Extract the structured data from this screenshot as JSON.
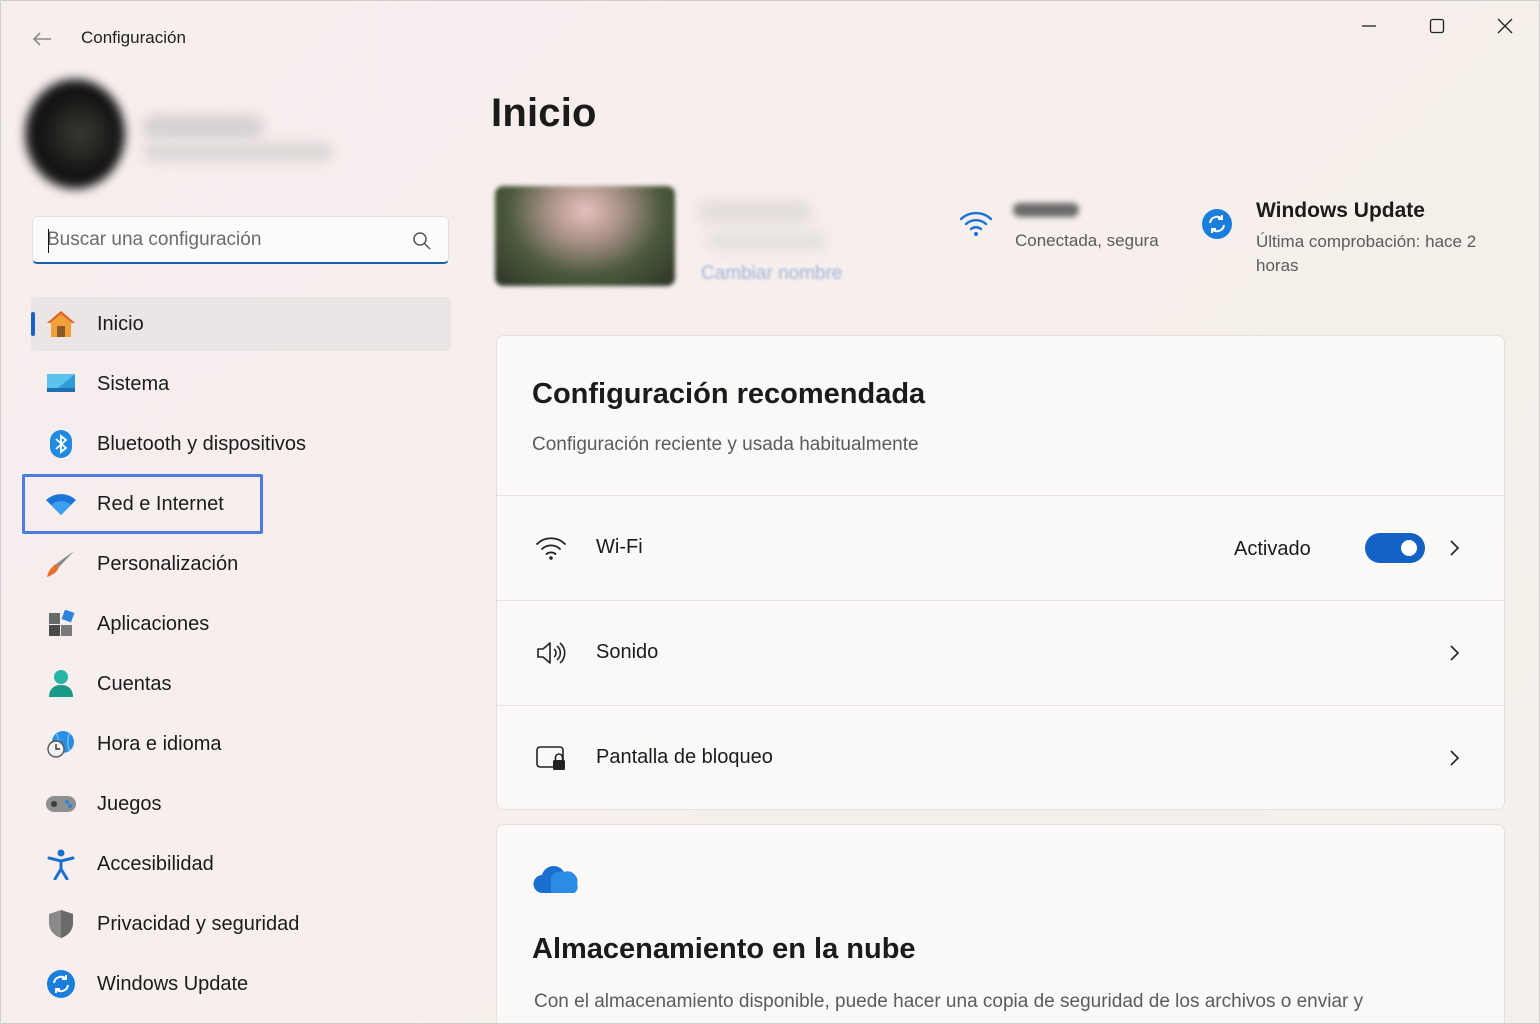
{
  "window": {
    "title": "Configuración"
  },
  "search": {
    "placeholder": "Buscar una configuración"
  },
  "sidebar": {
    "items": [
      {
        "label": "Inicio",
        "icon": "home-icon",
        "active": true
      },
      {
        "label": "Sistema",
        "icon": "system-icon"
      },
      {
        "label": "Bluetooth y dispositivos",
        "icon": "bluetooth-icon"
      },
      {
        "label": "Red e Internet",
        "icon": "wifi-icon",
        "highlighted": true
      },
      {
        "label": "Personalización",
        "icon": "brush-icon"
      },
      {
        "label": "Aplicaciones",
        "icon": "apps-icon"
      },
      {
        "label": "Cuentas",
        "icon": "account-icon"
      },
      {
        "label": "Hora e idioma",
        "icon": "clock-globe-icon"
      },
      {
        "label": "Juegos",
        "icon": "gamepad-icon"
      },
      {
        "label": "Accesibilidad",
        "icon": "accessibility-icon"
      },
      {
        "label": "Privacidad y seguridad",
        "icon": "shield-icon"
      },
      {
        "label": "Windows Update",
        "icon": "update-icon"
      }
    ]
  },
  "main": {
    "title": "Inicio",
    "device": {
      "rename_link": "Cambiar nombre"
    },
    "network": {
      "status": "Conectada, segura"
    },
    "windows_update": {
      "title": "Windows Update",
      "subtitle": "Última comprobación: hace 2 horas"
    },
    "recommended": {
      "title": "Configuración recomendada",
      "subtitle": "Configuración reciente y usada habitualmente",
      "rows": [
        {
          "label": "Wi-Fi",
          "value": "Activado",
          "toggle_on": true,
          "icon": "wifi-icon"
        },
        {
          "label": "Sonido",
          "icon": "speaker-icon"
        },
        {
          "label": "Pantalla de bloqueo",
          "icon": "lock-screen-icon"
        }
      ]
    },
    "cloud": {
      "title": "Almacenamiento en la nube",
      "text": "Con el almacenamiento disponible, puede hacer una copia de seguridad de los archivos o enviar y"
    }
  },
  "colors": {
    "accent": "#1361c5",
    "highlight_box": "#4c7dde"
  }
}
